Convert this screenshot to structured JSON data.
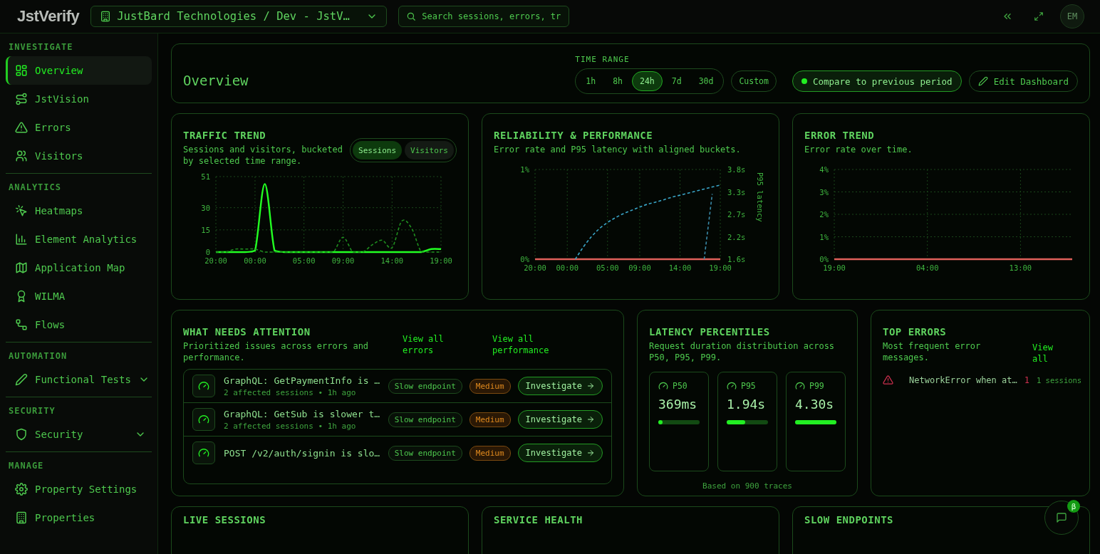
{
  "topbar": {
    "logo": "JstVerify",
    "project": "JustBard Technologies / Dev - JstV…",
    "search": {
      "placeholder": "Search sessions, errors, tr"
    },
    "avatar": "EM"
  },
  "sidebar": {
    "sections": [
      {
        "title": "INVESTIGATE",
        "items": [
          {
            "label": "Overview",
            "selected": true,
            "kind": "link"
          },
          {
            "label": "JstVision",
            "selected": false,
            "kind": "link"
          },
          {
            "label": "Errors",
            "selected": false,
            "kind": "link"
          },
          {
            "label": "Visitors",
            "selected": false,
            "kind": "link"
          }
        ]
      },
      {
        "title": "ANALYTICS",
        "items": [
          {
            "label": "Heatmaps",
            "selected": false,
            "kind": "link"
          },
          {
            "label": "Element Analytics",
            "selected": false,
            "kind": "link"
          },
          {
            "label": "Application Map",
            "selected": false,
            "kind": "link"
          },
          {
            "label": "WILMA",
            "selected": false,
            "kind": "link"
          },
          {
            "label": "Flows",
            "selected": false,
            "kind": "link"
          }
        ]
      },
      {
        "title": "AUTOMATION",
        "items": [
          {
            "label": "Functional Tests",
            "selected": false,
            "kind": "group",
            "expanded": false
          }
        ]
      },
      {
        "title": "SECURITY",
        "items": [
          {
            "label": "Security",
            "selected": false,
            "kind": "group",
            "expanded": false
          }
        ]
      },
      {
        "title": "MANAGE",
        "items": [
          {
            "label": "Property Settings",
            "selected": false,
            "kind": "link"
          },
          {
            "label": "Properties",
            "selected": false,
            "kind": "link"
          }
        ]
      }
    ]
  },
  "header": {
    "title": "Overview",
    "time_range": {
      "label": "TIME RANGE",
      "options": [
        {
          "label": "1h",
          "selected": false
        },
        {
          "label": "8h",
          "selected": false
        },
        {
          "label": "24h",
          "selected": true
        },
        {
          "label": "7d",
          "selected": false
        },
        {
          "label": "30d",
          "selected": false
        }
      ]
    },
    "custom": "Custom",
    "compare": {
      "label": "Compare to previous period",
      "on": true
    },
    "edit": "Edit Dashboard"
  },
  "traffic": {
    "title": "TRAFFIC TREND",
    "description": "Sessions and visitors, bucketed by selected time range.",
    "toggle": [
      {
        "label": "Sessions",
        "selected": true
      },
      {
        "label": "Visitors",
        "selected": false
      }
    ],
    "chart_data": {
      "type": "line",
      "categories": [
        "20:00",
        null,
        null,
        null,
        "00:00",
        null,
        null,
        null,
        null,
        "05:00",
        null,
        null,
        null,
        "09:00",
        null,
        null,
        null,
        null,
        "14:00",
        null,
        null,
        null,
        null,
        "19:00"
      ],
      "ylim": [
        0,
        51
      ],
      "yticks": [
        0,
        15,
        30,
        51
      ],
      "grid": true,
      "series": [
        {
          "color": "#22ff22",
          "line_style": "solid",
          "values": [
            0,
            0,
            0,
            0,
            1,
            46,
            1,
            0,
            0,
            0,
            0,
            0,
            0,
            0,
            0,
            0,
            0,
            0,
            0,
            0,
            0,
            0,
            2,
            2
          ]
        },
        {
          "color": "#1f8f1f",
          "line_style": "dashed",
          "values": [
            0,
            0,
            2,
            2,
            2,
            0,
            0,
            0,
            0,
            0,
            0,
            0,
            0,
            10,
            0,
            0,
            5,
            8,
            3,
            21,
            16,
            0,
            0,
            0
          ]
        }
      ]
    }
  },
  "reliability": {
    "title": "RELIABILITY & PERFORMANCE",
    "description": "Error rate and P95 latency with aligned buckets.",
    "chart_data": {
      "type": "line",
      "categories": [
        "20:00",
        null,
        null,
        null,
        "00:00",
        null,
        null,
        null,
        null,
        "05:00",
        null,
        null,
        null,
        "09:00",
        null,
        null,
        null,
        null,
        "14:00",
        null,
        null,
        null,
        null,
        "19:00"
      ],
      "ylim": [
        0,
        1
      ],
      "yticks": [
        {
          "value": 0,
          "label": "0%"
        },
        {
          "value": 1,
          "label": "1%"
        }
      ],
      "y2label": "P95 latency",
      "y2lim": [
        1.6,
        3.8
      ],
      "y2ticks": [
        {
          "value": 1.6,
          "label": "1.6s"
        },
        {
          "value": 2.15,
          "label": "2.2s"
        },
        {
          "value": 2.7,
          "label": "2.7s"
        },
        {
          "value": 3.25,
          "label": "3.3s"
        },
        {
          "value": 3.8,
          "label": "3.8s"
        }
      ],
      "grid": true,
      "series": [
        {
          "color": "#e0605a",
          "line_style": "solid",
          "values": [
            0,
            0,
            0,
            0,
            0,
            0,
            0,
            0,
            0,
            0,
            0,
            0,
            0,
            0,
            0,
            0,
            0,
            0,
            0,
            0,
            0,
            0,
            0,
            0
          ]
        },
        {
          "color": "#3aa6c8",
          "line_style": "dashed",
          "axis": "y2",
          "values": [
            null,
            null,
            null,
            null,
            null,
            1.6,
            1.9,
            2.15,
            2.35,
            2.5,
            2.62,
            2.72,
            2.8,
            2.88,
            2.95,
            3.0,
            3.06,
            3.12,
            3.17,
            3.22,
            3.27,
            3.32,
            3.37,
            3.42
          ]
        },
        {
          "color": "#3a8aa8",
          "line_style": "dashed",
          "axis": "y2",
          "values": [
            null,
            null,
            null,
            null,
            null,
            null,
            null,
            null,
            null,
            null,
            null,
            null,
            null,
            null,
            null,
            null,
            null,
            null,
            null,
            null,
            null,
            1.6,
            3.2,
            null
          ]
        }
      ]
    }
  },
  "error_trend": {
    "title": "ERROR TREND",
    "description": "Error rate over time.",
    "chart_data": {
      "type": "line",
      "categories": [
        "19:00",
        null,
        null,
        null,
        null,
        null,
        null,
        null,
        null,
        "04:00",
        null,
        null,
        null,
        null,
        null,
        null,
        null,
        null,
        "13:00",
        null,
        null,
        null,
        null,
        null
      ],
      "ylim": [
        0,
        4
      ],
      "yticks": [
        {
          "value": 0,
          "label": "0%"
        },
        {
          "value": 1,
          "label": "1%"
        },
        {
          "value": 2,
          "label": "2%"
        },
        {
          "value": 3,
          "label": "3%"
        },
        {
          "value": 4,
          "label": "4%"
        }
      ],
      "grid": true,
      "series": [
        {
          "color": "#e0605a",
          "line_style": "solid",
          "values": [
            0,
            0,
            0,
            0,
            0,
            0,
            0,
            0,
            0,
            0,
            0,
            0,
            0,
            0,
            0,
            0,
            0,
            0,
            0,
            0,
            0,
            0,
            0,
            0
          ]
        }
      ]
    }
  },
  "attention": {
    "title": "WHAT NEEDS ATTENTION",
    "description": "Prioritized issues across errors and performance.",
    "links": [
      "View all errors",
      "View all performance"
    ],
    "issues": [
      {
        "title": "GraphQL: GetPaymentInfo is …",
        "meta": "2 affected sessions • 1h ago",
        "tag": "Slow endpoint",
        "severity": {
          "text": "Medium",
          "kind": "medium"
        },
        "action": "Investigate"
      },
      {
        "title": "GraphQL: GetSub is slower t…",
        "meta": "2 affected sessions • 1h ago",
        "tag": "Slow endpoint",
        "severity": {
          "text": "Medium",
          "kind": "medium"
        },
        "action": "Investigate"
      },
      {
        "title": "POST /v2/auth/signin is slo…",
        "tag": "Slow endpoint",
        "severity": {
          "text": "Medium",
          "kind": "medium"
        },
        "action": "Investigate"
      }
    ]
  },
  "latency": {
    "title": "LATENCY PERCENTILES",
    "description": "Request duration distribution across P50, P95, P99.",
    "tiles": [
      {
        "label": "P50",
        "value": "369ms",
        "level": 0.04
      },
      {
        "label": "P95",
        "value": "1.94s",
        "level": 0.45
      },
      {
        "label": "P99",
        "value": "4.30s",
        "level": 1
      }
    ],
    "footer": "Based on 900 traces"
  },
  "top_errors": {
    "title": "TOP ERRORS",
    "description": "Most frequent error messages.",
    "link": "View all",
    "errors": [
      {
        "message": "NetworkError when at…",
        "count": "1",
        "sessions": "1 sessions"
      }
    ]
  },
  "more_cards": [
    {
      "title": "LIVE SESSIONS"
    },
    {
      "title": "SERVICE HEALTH"
    },
    {
      "title": "SLOW ENDPOINTS"
    }
  ],
  "chat": {
    "badge": "β"
  }
}
